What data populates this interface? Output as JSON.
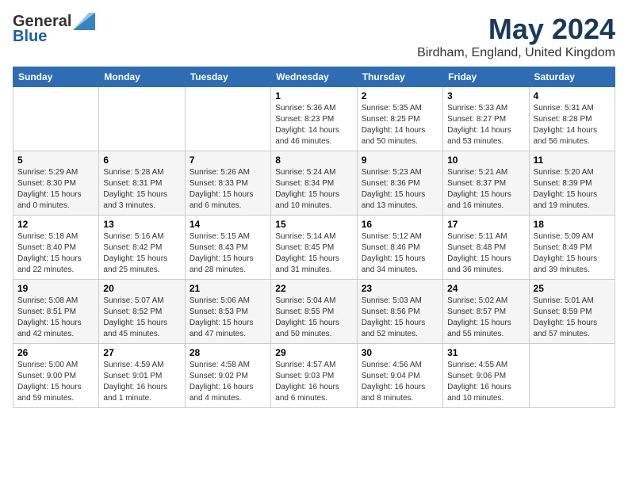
{
  "header": {
    "logo_general": "General",
    "logo_blue": "Blue",
    "title": "May 2024",
    "location": "Birdham, England, United Kingdom"
  },
  "weekdays": [
    "Sunday",
    "Monday",
    "Tuesday",
    "Wednesday",
    "Thursday",
    "Friday",
    "Saturday"
  ],
  "weeks": [
    [
      {
        "day": "",
        "info": ""
      },
      {
        "day": "",
        "info": ""
      },
      {
        "day": "",
        "info": ""
      },
      {
        "day": "1",
        "info": "Sunrise: 5:36 AM\nSunset: 8:23 PM\nDaylight: 14 hours\nand 46 minutes."
      },
      {
        "day": "2",
        "info": "Sunrise: 5:35 AM\nSunset: 8:25 PM\nDaylight: 14 hours\nand 50 minutes."
      },
      {
        "day": "3",
        "info": "Sunrise: 5:33 AM\nSunset: 8:27 PM\nDaylight: 14 hours\nand 53 minutes."
      },
      {
        "day": "4",
        "info": "Sunrise: 5:31 AM\nSunset: 8:28 PM\nDaylight: 14 hours\nand 56 minutes."
      }
    ],
    [
      {
        "day": "5",
        "info": "Sunrise: 5:29 AM\nSunset: 8:30 PM\nDaylight: 15 hours\nand 0 minutes."
      },
      {
        "day": "6",
        "info": "Sunrise: 5:28 AM\nSunset: 8:31 PM\nDaylight: 15 hours\nand 3 minutes."
      },
      {
        "day": "7",
        "info": "Sunrise: 5:26 AM\nSunset: 8:33 PM\nDaylight: 15 hours\nand 6 minutes."
      },
      {
        "day": "8",
        "info": "Sunrise: 5:24 AM\nSunset: 8:34 PM\nDaylight: 15 hours\nand 10 minutes."
      },
      {
        "day": "9",
        "info": "Sunrise: 5:23 AM\nSunset: 8:36 PM\nDaylight: 15 hours\nand 13 minutes."
      },
      {
        "day": "10",
        "info": "Sunrise: 5:21 AM\nSunset: 8:37 PM\nDaylight: 15 hours\nand 16 minutes."
      },
      {
        "day": "11",
        "info": "Sunrise: 5:20 AM\nSunset: 8:39 PM\nDaylight: 15 hours\nand 19 minutes."
      }
    ],
    [
      {
        "day": "12",
        "info": "Sunrise: 5:18 AM\nSunset: 8:40 PM\nDaylight: 15 hours\nand 22 minutes."
      },
      {
        "day": "13",
        "info": "Sunrise: 5:16 AM\nSunset: 8:42 PM\nDaylight: 15 hours\nand 25 minutes."
      },
      {
        "day": "14",
        "info": "Sunrise: 5:15 AM\nSunset: 8:43 PM\nDaylight: 15 hours\nand 28 minutes."
      },
      {
        "day": "15",
        "info": "Sunrise: 5:14 AM\nSunset: 8:45 PM\nDaylight: 15 hours\nand 31 minutes."
      },
      {
        "day": "16",
        "info": "Sunrise: 5:12 AM\nSunset: 8:46 PM\nDaylight: 15 hours\nand 34 minutes."
      },
      {
        "day": "17",
        "info": "Sunrise: 5:11 AM\nSunset: 8:48 PM\nDaylight: 15 hours\nand 36 minutes."
      },
      {
        "day": "18",
        "info": "Sunrise: 5:09 AM\nSunset: 8:49 PM\nDaylight: 15 hours\nand 39 minutes."
      }
    ],
    [
      {
        "day": "19",
        "info": "Sunrise: 5:08 AM\nSunset: 8:51 PM\nDaylight: 15 hours\nand 42 minutes."
      },
      {
        "day": "20",
        "info": "Sunrise: 5:07 AM\nSunset: 8:52 PM\nDaylight: 15 hours\nand 45 minutes."
      },
      {
        "day": "21",
        "info": "Sunrise: 5:06 AM\nSunset: 8:53 PM\nDaylight: 15 hours\nand 47 minutes."
      },
      {
        "day": "22",
        "info": "Sunrise: 5:04 AM\nSunset: 8:55 PM\nDaylight: 15 hours\nand 50 minutes."
      },
      {
        "day": "23",
        "info": "Sunrise: 5:03 AM\nSunset: 8:56 PM\nDaylight: 15 hours\nand 52 minutes."
      },
      {
        "day": "24",
        "info": "Sunrise: 5:02 AM\nSunset: 8:57 PM\nDaylight: 15 hours\nand 55 minutes."
      },
      {
        "day": "25",
        "info": "Sunrise: 5:01 AM\nSunset: 8:59 PM\nDaylight: 15 hours\nand 57 minutes."
      }
    ],
    [
      {
        "day": "26",
        "info": "Sunrise: 5:00 AM\nSunset: 9:00 PM\nDaylight: 15 hours\nand 59 minutes."
      },
      {
        "day": "27",
        "info": "Sunrise: 4:59 AM\nSunset: 9:01 PM\nDaylight: 16 hours\nand 1 minute."
      },
      {
        "day": "28",
        "info": "Sunrise: 4:58 AM\nSunset: 9:02 PM\nDaylight: 16 hours\nand 4 minutes."
      },
      {
        "day": "29",
        "info": "Sunrise: 4:57 AM\nSunset: 9:03 PM\nDaylight: 16 hours\nand 6 minutes."
      },
      {
        "day": "30",
        "info": "Sunrise: 4:56 AM\nSunset: 9:04 PM\nDaylight: 16 hours\nand 8 minutes."
      },
      {
        "day": "31",
        "info": "Sunrise: 4:55 AM\nSunset: 9:06 PM\nDaylight: 16 hours\nand 10 minutes."
      },
      {
        "day": "",
        "info": ""
      }
    ]
  ]
}
